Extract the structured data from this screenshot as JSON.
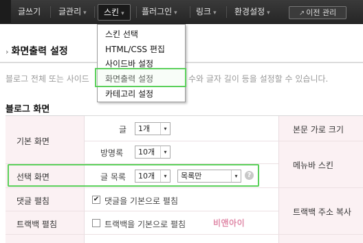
{
  "nav": {
    "items": [
      {
        "label": "글쓰기",
        "has_menu": false
      },
      {
        "label": "글관리",
        "has_menu": true
      },
      {
        "label": "스킨",
        "has_menu": true,
        "active": true
      },
      {
        "label": "플러그인",
        "has_menu": true
      },
      {
        "label": "링크",
        "has_menu": true
      },
      {
        "label": "환경설정",
        "has_menu": true
      }
    ],
    "chevron": "▾",
    "prev_admin_label": "이전 관리",
    "prev_admin_icon": "↗"
  },
  "dropdown": {
    "items": [
      "스킨 선택",
      "HTML/CSS 편집",
      "사이드바 설정",
      "화면출력 설정",
      "카테고리 설정"
    ],
    "selected_index": 3
  },
  "page": {
    "title": "화면출력 설정",
    "bullet": "›",
    "desc_left": "블로그 전체 또는 사이드",
    "desc_right": "수와 글자 길이 등을 설정할 수 있습니다."
  },
  "section": {
    "title": "블로그 화면"
  },
  "settings": {
    "default_screen": {
      "label": "기본 화면",
      "posts_label": "글",
      "posts_value": "1개",
      "guestbook_label": "방명록",
      "guestbook_value": "10개"
    },
    "selected_screen": {
      "label": "선택 화면",
      "list_label": "글 목록",
      "list_count_value": "10개",
      "list_mode_value": "목록만",
      "help": "?"
    },
    "comment_expand": {
      "label": "댓글 펼침",
      "checkbox_label": "댓글을 기본으로 펼침",
      "checked": true
    },
    "trackback_expand": {
      "label": "트랙백 펼침",
      "checkbox_label": "트랙백을 기본으로 펼침",
      "checked": false
    },
    "right_labels": {
      "body_width": "본문 가로 크기",
      "menubar_skin": "메뉴바 스킨",
      "trackback_copy": "트랙백 주소 복사"
    }
  },
  "watermark": "비앤아이",
  "colors": {
    "nav_bg": "#2e2e2e",
    "highlight_green": "#5ad05a",
    "label_bg_pink": "#fbf1f3",
    "watermark_pink": "#e08aa8"
  },
  "icons": {
    "caret": "▾",
    "check": "✔"
  }
}
